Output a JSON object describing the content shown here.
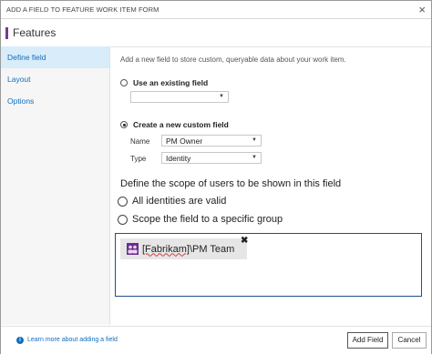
{
  "dialog": {
    "title": "ADD A FIELD TO FEATURE WORK ITEM FORM",
    "close_glyph": "×",
    "header_title": "Features",
    "accent_color": "#773b93"
  },
  "sidebar": {
    "items": [
      {
        "label": "Define field",
        "active": true
      },
      {
        "label": "Layout",
        "active": false
      },
      {
        "label": "Options",
        "active": false
      }
    ]
  },
  "main": {
    "description": "Add a new field to store custom, queryable data about your work item.",
    "existing": {
      "label": "Use an existing field",
      "selected": false,
      "value": ""
    },
    "custom": {
      "label": "Create a new custom field",
      "selected": true,
      "name_label": "Name",
      "name_value": "PM Owner",
      "type_label": "Type",
      "type_value": "Identity"
    },
    "scope": {
      "title": "Define the scope of users to be shown in this field",
      "option_all": "All identities are valid",
      "option_group": "Scope the field to a specific group",
      "selected": "group"
    },
    "group_chip": {
      "prefix": "[Fabrikam]",
      "suffix": "\\PM Team",
      "remove_glyph": "✖"
    }
  },
  "footer": {
    "info_glyph": "i",
    "learn_more": "Learn more about adding a field",
    "add_button": "Add Field",
    "cancel_button": "Cancel"
  }
}
